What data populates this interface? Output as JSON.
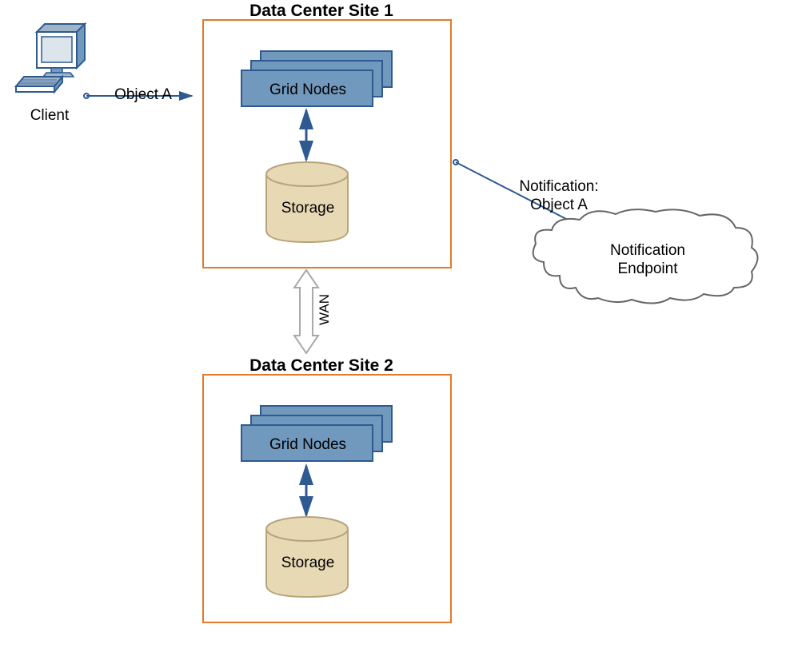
{
  "client": {
    "label": "Client"
  },
  "objectA": {
    "label": "Object A"
  },
  "site1": {
    "title": "Data Center Site 1",
    "gridNodesLabel": "Grid Nodes",
    "storageLabel": "Storage"
  },
  "site2": {
    "title": "Data Center Site 2",
    "gridNodesLabel": "Grid Nodes",
    "storageLabel": "Storage"
  },
  "wan": {
    "label": "WAN"
  },
  "notification": {
    "line1": "Notification:",
    "line2": "Object A",
    "endpointLine1": "Notification",
    "endpointLine2": "Endpoint"
  },
  "colors": {
    "blueOutline": "#2E5A91",
    "blueFill": "#7198BD",
    "orange": "#E17A2A",
    "tan": "#E8D9B5",
    "tanDark": "#B8A47A",
    "gray": "#A9A9A9"
  }
}
